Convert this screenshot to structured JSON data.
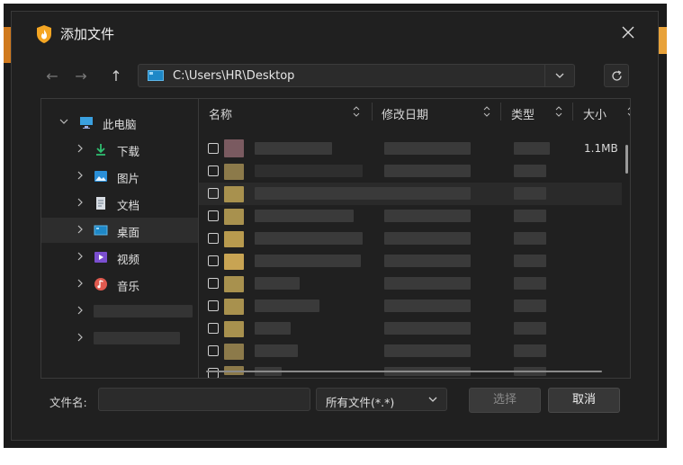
{
  "dialog": {
    "title": "添加文件",
    "address_path": "C:\\Users\\HR\\Desktop"
  },
  "sidebar": {
    "root": "此电脑",
    "items": [
      {
        "label": "下载",
        "icon": "download-icon"
      },
      {
        "label": "图片",
        "icon": "pictures-icon"
      },
      {
        "label": "文档",
        "icon": "documents-icon"
      },
      {
        "label": "桌面",
        "icon": "desktop-icon"
      },
      {
        "label": "视频",
        "icon": "videos-icon"
      },
      {
        "label": "音乐",
        "icon": "music-icon"
      }
    ]
  },
  "columns": [
    "名称",
    "修改日期",
    "类型",
    "大小"
  ],
  "first_row_size": "1.1MB",
  "footer": {
    "filename_label": "文件名:",
    "filename_value": "",
    "filetype": "所有文件(*.*)",
    "select_button": "选择",
    "cancel_button": "取消"
  },
  "colors": {
    "dialog_bg": "#202020",
    "accent_icon": "#f5a623"
  }
}
